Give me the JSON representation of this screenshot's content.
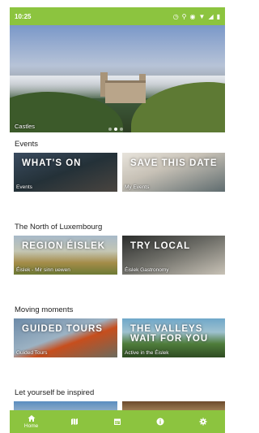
{
  "status_bar": {
    "time": "10:25"
  },
  "hero": {
    "caption": "Castles",
    "dots": 3,
    "active_dot": 1
  },
  "sections": [
    {
      "title": "Events",
      "tiles": [
        {
          "label": "WHAT'S ON",
          "caption": "Events"
        },
        {
          "label": "SAVE THIS DATE",
          "caption": "My Events"
        }
      ]
    },
    {
      "title": "The North of Luxembourg",
      "tiles": [
        {
          "label": "REGION ÉISLEK",
          "caption": "Éislek - Mir sinn uewen"
        },
        {
          "label": "TRY LOCAL",
          "caption": "Éislek Gastronomy"
        }
      ]
    },
    {
      "title": "Moving moments",
      "tiles": [
        {
          "label": "GUIDED TOURS",
          "caption": "Guided Tours"
        },
        {
          "label": "THE VALLEYS WAIT FOR YOU",
          "caption": "Active in the Éislek"
        }
      ]
    },
    {
      "title": "Let yourself be inspired",
      "tiles": [
        {
          "label": "",
          "caption": ""
        },
        {
          "label": "",
          "caption": ""
        }
      ]
    }
  ],
  "nav": [
    {
      "label": "Home",
      "icon": "home-icon"
    },
    {
      "label": "",
      "icon": "map-icon"
    },
    {
      "label": "",
      "icon": "calendar-icon"
    },
    {
      "label": "",
      "icon": "info-icon"
    },
    {
      "label": "",
      "icon": "settings-icon"
    }
  ],
  "colors": {
    "accent": "#8cc43f"
  }
}
